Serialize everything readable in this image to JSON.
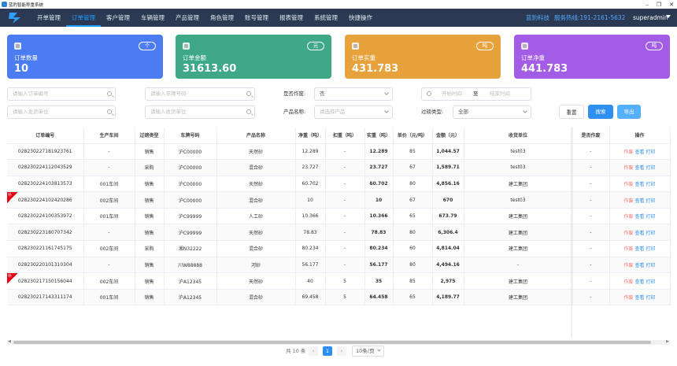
{
  "window": {
    "title": "蓝豹智能称重系统"
  },
  "nav": {
    "items": [
      "开单管理",
      "订单管理",
      "客户管理",
      "车辆管理",
      "产品管理",
      "角色管理",
      "账号管理",
      "报表管理",
      "系统管理",
      "快捷操作"
    ],
    "company": "蓝豹科技",
    "hotline": "服务热线:191-2161-5632",
    "user": "superadmin"
  },
  "cards": [
    {
      "title": "订单数量",
      "value": "10",
      "unit": "个",
      "color": "#4b7cf2"
    },
    {
      "title": "订单金额",
      "value": "31613.60",
      "unit": "元",
      "color": "#3ea887"
    },
    {
      "title": "订单实重",
      "value": "431.783",
      "unit": "吨",
      "color": "#e8a23c"
    },
    {
      "title": "订单净重",
      "value": "441.783",
      "unit": "吨",
      "color": "#a35ce6"
    }
  ],
  "filters": {
    "order_no_placeholder": "请输入订单编号",
    "plate_placeholder": "请输入车牌号码",
    "void_label": "是否作废:",
    "void_value": "否",
    "start_placeholder": "开始时间",
    "to_label": "至",
    "end_placeholder": "结束时间",
    "shipper_placeholder": "请输入发货单位",
    "receiver_placeholder": "请输入收货单位",
    "product_label": "产品名称:",
    "product_placeholder": "请选择产品",
    "weigh_type_label": "过磅类型:",
    "weigh_type_value": "全部",
    "reset": "重置",
    "search": "搜索",
    "export": "导出"
  },
  "table": {
    "columns": [
      "订单编号",
      "生产车间",
      "过磅类型",
      "车牌号码",
      "产品名称",
      "净重（吨）",
      "扣重（吨）",
      "实重（吨）",
      "单价（元/吨）",
      "金额（元）",
      "收货单位",
      "是否作废",
      "操作"
    ],
    "actions": [
      "作废",
      "查看",
      "打印"
    ],
    "badge": "补",
    "rows": [
      {
        "id": "028230227181923761",
        "workshop": "-",
        "type": "销售",
        "plate": "沪C00000",
        "product": "天然砂",
        "net": "12.289",
        "deduct": "-",
        "actual": "12.289",
        "price": "85",
        "amount": "1,044.57",
        "receiver": "test03",
        "void": "-",
        "badge": false
      },
      {
        "id": "028230224112043529",
        "workshop": "-",
        "type": "采购",
        "plate": "沪C00000",
        "product": "混合砂",
        "net": "23.727",
        "deduct": "-",
        "actual": "23.727",
        "price": "67",
        "amount": "1,589.71",
        "receiver": "test03",
        "void": "-",
        "badge": false
      },
      {
        "id": "028230224103813573",
        "workshop": "001车间",
        "type": "销售",
        "plate": "沪C00000",
        "product": "天然砂",
        "net": "60.702",
        "deduct": "-",
        "actual": "60.702",
        "price": "80",
        "amount": "4,856.16",
        "receiver": "建工集团",
        "void": "-",
        "badge": false
      },
      {
        "id": "028230224102420286",
        "workshop": "002车间",
        "type": "销售",
        "plate": "沪C00000",
        "product": "混合砂",
        "net": "10",
        "deduct": "-",
        "actual": "10",
        "price": "67",
        "amount": "670",
        "receiver": "test03",
        "void": "-",
        "badge": true
      },
      {
        "id": "028230224100353972",
        "workshop": "001车间",
        "type": "销售",
        "plate": "沪C99999",
        "product": "人工砂",
        "net": "10.366",
        "deduct": "-",
        "actual": "10.366",
        "price": "65",
        "amount": "673.79",
        "receiver": "建工集团",
        "void": "-",
        "badge": false
      },
      {
        "id": "028230223180707342",
        "workshop": "-",
        "type": "销售",
        "plate": "沪C99999",
        "product": "天然砂",
        "net": "78.83",
        "deduct": "-",
        "actual": "78.83",
        "price": "80",
        "amount": "6,306.4",
        "receiver": "建工集团",
        "void": "-",
        "badge": false
      },
      {
        "id": "028230221161745175",
        "workshop": "002车间",
        "type": "采购",
        "plate": "湘N32222",
        "product": "混合砂",
        "net": "80.234",
        "deduct": "-",
        "actual": "80.234",
        "price": "60",
        "amount": "4,814.04",
        "receiver": "建工集团",
        "void": "-",
        "badge": false
      },
      {
        "id": "028230220101310304",
        "workshop": "-",
        "type": "销售",
        "plate": "川W88888",
        "product": "河砂",
        "net": "56.177",
        "deduct": "-",
        "actual": "56.177",
        "price": "80",
        "amount": "4,494.16",
        "receiver": "-",
        "void": "-",
        "badge": false
      },
      {
        "id": "028230217150156044",
        "workshop": "002车间",
        "type": "销售",
        "plate": "沪A12345",
        "product": "天然砂",
        "net": "40",
        "deduct": "5",
        "actual": "35",
        "price": "85",
        "amount": "2,975",
        "receiver": "建工集团",
        "void": "-",
        "badge": true
      },
      {
        "id": "028230217143311174",
        "workshop": "001车间",
        "type": "销售",
        "plate": "沪A12345",
        "product": "混合砂",
        "net": "69.458",
        "deduct": "5",
        "actual": "64.458",
        "price": "65",
        "amount": "4,189.77",
        "receiver": "建工集团",
        "void": "-",
        "badge": false
      }
    ]
  },
  "pagination": {
    "total": "共 10 条",
    "current": "1",
    "page_size": "10条/页",
    "prev": "‹",
    "next": "›"
  }
}
